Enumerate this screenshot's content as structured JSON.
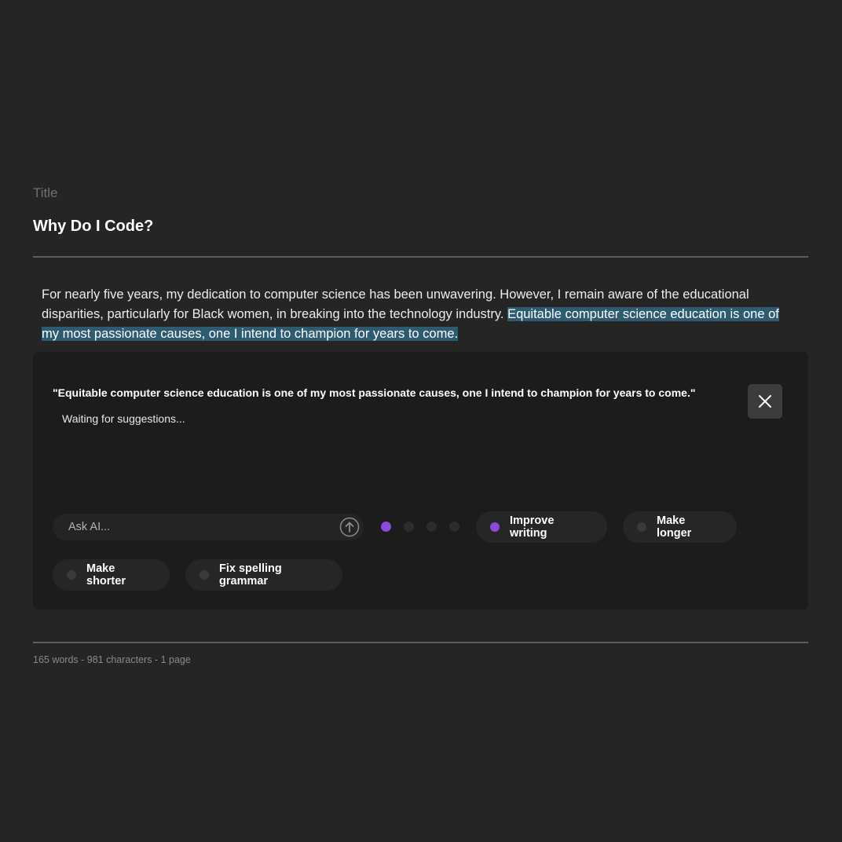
{
  "document": {
    "title_label": "Title",
    "title": "Why Do I Code?",
    "body_plain": "For nearly five years, my dedication to computer science has been unwavering. However, I remain aware of the educational disparities, particularly for Black women, in breaking into the technology industry. ",
    "body_selected": "Equitable computer science education is one of my most passionate causes, one I intend to champion for years to come."
  },
  "ai_panel": {
    "quote": "\"Equitable computer science education is one of my most passionate causes, one I intend to champion for years to come.\"",
    "status": "Waiting for suggestions...",
    "close_icon": "close-icon",
    "ask": {
      "placeholder": "Ask AI...",
      "value": "",
      "send_icon": "arrow-up-circle-icon"
    },
    "pager": {
      "count": 4,
      "active_index": 0
    },
    "actions": [
      {
        "label": "Improve writing",
        "selected": true
      },
      {
        "label": "Make longer",
        "selected": false
      },
      {
        "label": "Make shorter",
        "selected": false
      },
      {
        "label": "Fix spelling grammar",
        "selected": false
      }
    ]
  },
  "footer": {
    "stats": "165 words - 981 characters - 1 page"
  },
  "colors": {
    "background": "#252525",
    "panel": "#1c1c1c",
    "selection": "#2d5c70",
    "accent": "#8a4ae0"
  }
}
